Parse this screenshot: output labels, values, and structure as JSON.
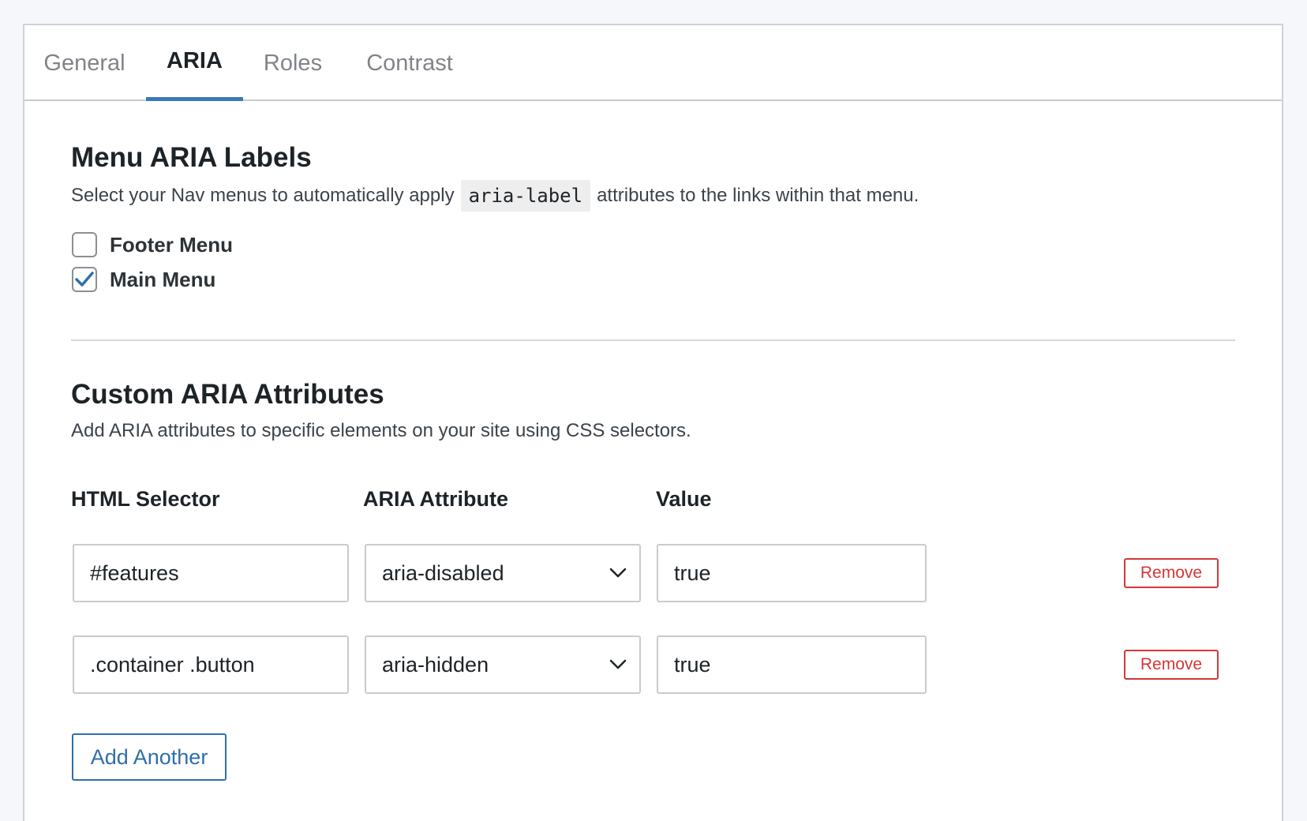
{
  "tabs": [
    {
      "label": "General"
    },
    {
      "label": "ARIA"
    },
    {
      "label": "Roles"
    },
    {
      "label": "Contrast"
    }
  ],
  "active_tab": "ARIA",
  "menu_labels": {
    "title": "Menu ARIA Labels",
    "desc_before": "Select your Nav menus to automatically apply",
    "desc_code": "aria-label",
    "desc_after": "attributes to the links within that menu.",
    "menus": [
      {
        "label": "Footer Menu",
        "checked": false
      },
      {
        "label": "Main Menu",
        "checked": true
      }
    ]
  },
  "custom_attrs": {
    "title": "Custom ARIA Attributes",
    "desc": "Add ARIA attributes to specific elements on your site using CSS selectors.",
    "headers": {
      "selector": "HTML Selector",
      "attribute": "ARIA Attribute",
      "value": "Value"
    },
    "rows": [
      {
        "selector": "#features",
        "attribute": "aria-disabled",
        "value": "true",
        "remove_label": "Remove"
      },
      {
        "selector": ".container .button",
        "attribute": "aria-hidden",
        "value": "true",
        "remove_label": "Remove"
      }
    ],
    "add_label": "Add Another"
  },
  "colors": {
    "accent": "#3a79b8",
    "danger": "#d63638",
    "checkmark": "#2f6fab"
  }
}
